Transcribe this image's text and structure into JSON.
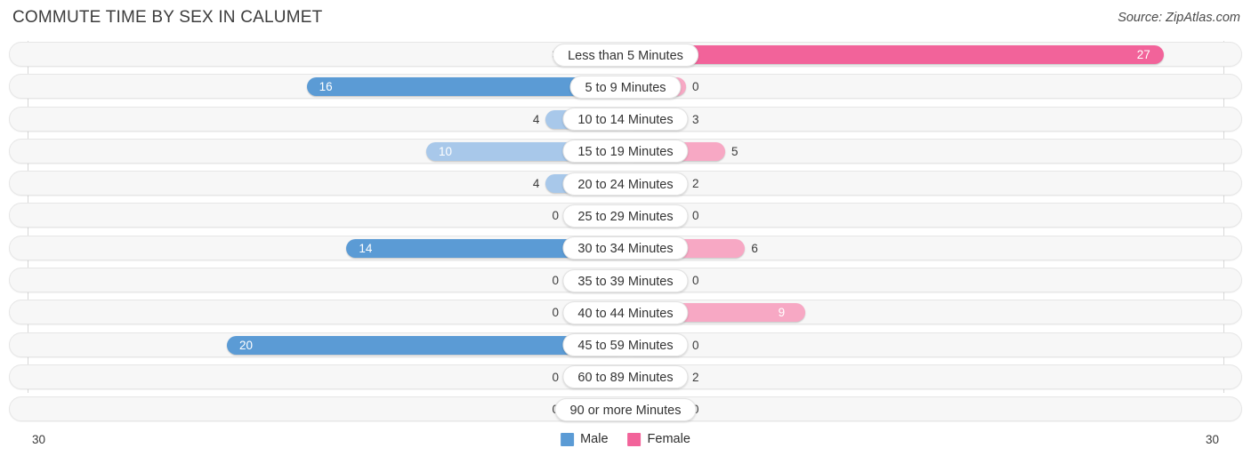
{
  "header": {
    "title": "COMMUTE TIME BY SEX IN CALUMET",
    "source": "Source: ZipAtlas.com"
  },
  "axis": {
    "left_label": "30",
    "right_label": "30"
  },
  "legend": {
    "items": [
      {
        "label": "Male",
        "color": "#5B9BD5"
      },
      {
        "label": "Female",
        "color": "#F2639A"
      }
    ]
  },
  "colors": {
    "male_strong": "#5B9BD5",
    "male_light": "#A8C8EA",
    "female_strong": "#F2639A",
    "female_light": "#F7A8C4",
    "track": "#f7f7f7",
    "track_border": "#e6e6e6",
    "gridline": "#d8d8d8",
    "title": "#3c3c3c"
  },
  "chart_data": {
    "type": "bar",
    "subtype": "diverging-bidirectional",
    "title": "COMMUTE TIME BY SEX IN CALUMET",
    "xlabel": "",
    "ylabel": "",
    "xlim": [
      30,
      30
    ],
    "axis_max": 30,
    "grid": true,
    "legend_position": "bottom-center",
    "categories": [
      "Less than 5 Minutes",
      "5 to 9 Minutes",
      "10 to 14 Minutes",
      "15 to 19 Minutes",
      "20 to 24 Minutes",
      "25 to 29 Minutes",
      "30 to 34 Minutes",
      "35 to 39 Minutes",
      "40 to 44 Minutes",
      "45 to 59 Minutes",
      "60 to 89 Minutes",
      "90 or more Minutes"
    ],
    "series": [
      {
        "name": "Male",
        "color": "#5B9BD5",
        "direction": "left",
        "values": [
          3,
          16,
          4,
          10,
          4,
          0,
          14,
          0,
          0,
          20,
          0,
          0
        ]
      },
      {
        "name": "Female",
        "color": "#F2639A",
        "direction": "right",
        "values": [
          27,
          0,
          3,
          5,
          2,
          0,
          6,
          0,
          9,
          0,
          2,
          0
        ]
      }
    ]
  },
  "rows": [
    {
      "label": "Less than 5 Minutes",
      "male": "3",
      "male_v": 3,
      "female": "27",
      "female_v": 27
    },
    {
      "label": "5 to 9 Minutes",
      "male": "16",
      "male_v": 16,
      "female": "0",
      "female_v": 0
    },
    {
      "label": "10 to 14 Minutes",
      "male": "4",
      "male_v": 4,
      "female": "3",
      "female_v": 3
    },
    {
      "label": "15 to 19 Minutes",
      "male": "10",
      "male_v": 10,
      "female": "5",
      "female_v": 5
    },
    {
      "label": "20 to 24 Minutes",
      "male": "4",
      "male_v": 4,
      "female": "2",
      "female_v": 2
    },
    {
      "label": "25 to 29 Minutes",
      "male": "0",
      "male_v": 0,
      "female": "0",
      "female_v": 0
    },
    {
      "label": "30 to 34 Minutes",
      "male": "14",
      "male_v": 14,
      "female": "6",
      "female_v": 6
    },
    {
      "label": "35 to 39 Minutes",
      "male": "0",
      "male_v": 0,
      "female": "0",
      "female_v": 0
    },
    {
      "label": "40 to 44 Minutes",
      "male": "0",
      "male_v": 0,
      "female": "9",
      "female_v": 9
    },
    {
      "label": "45 to 59 Minutes",
      "male": "20",
      "male_v": 20,
      "female": "0",
      "female_v": 0
    },
    {
      "label": "60 to 89 Minutes",
      "male": "0",
      "male_v": 0,
      "female": "2",
      "female_v": 2
    },
    {
      "label": "90 or more Minutes",
      "male": "0",
      "male_v": 0,
      "female": "0",
      "female_v": 0
    }
  ]
}
